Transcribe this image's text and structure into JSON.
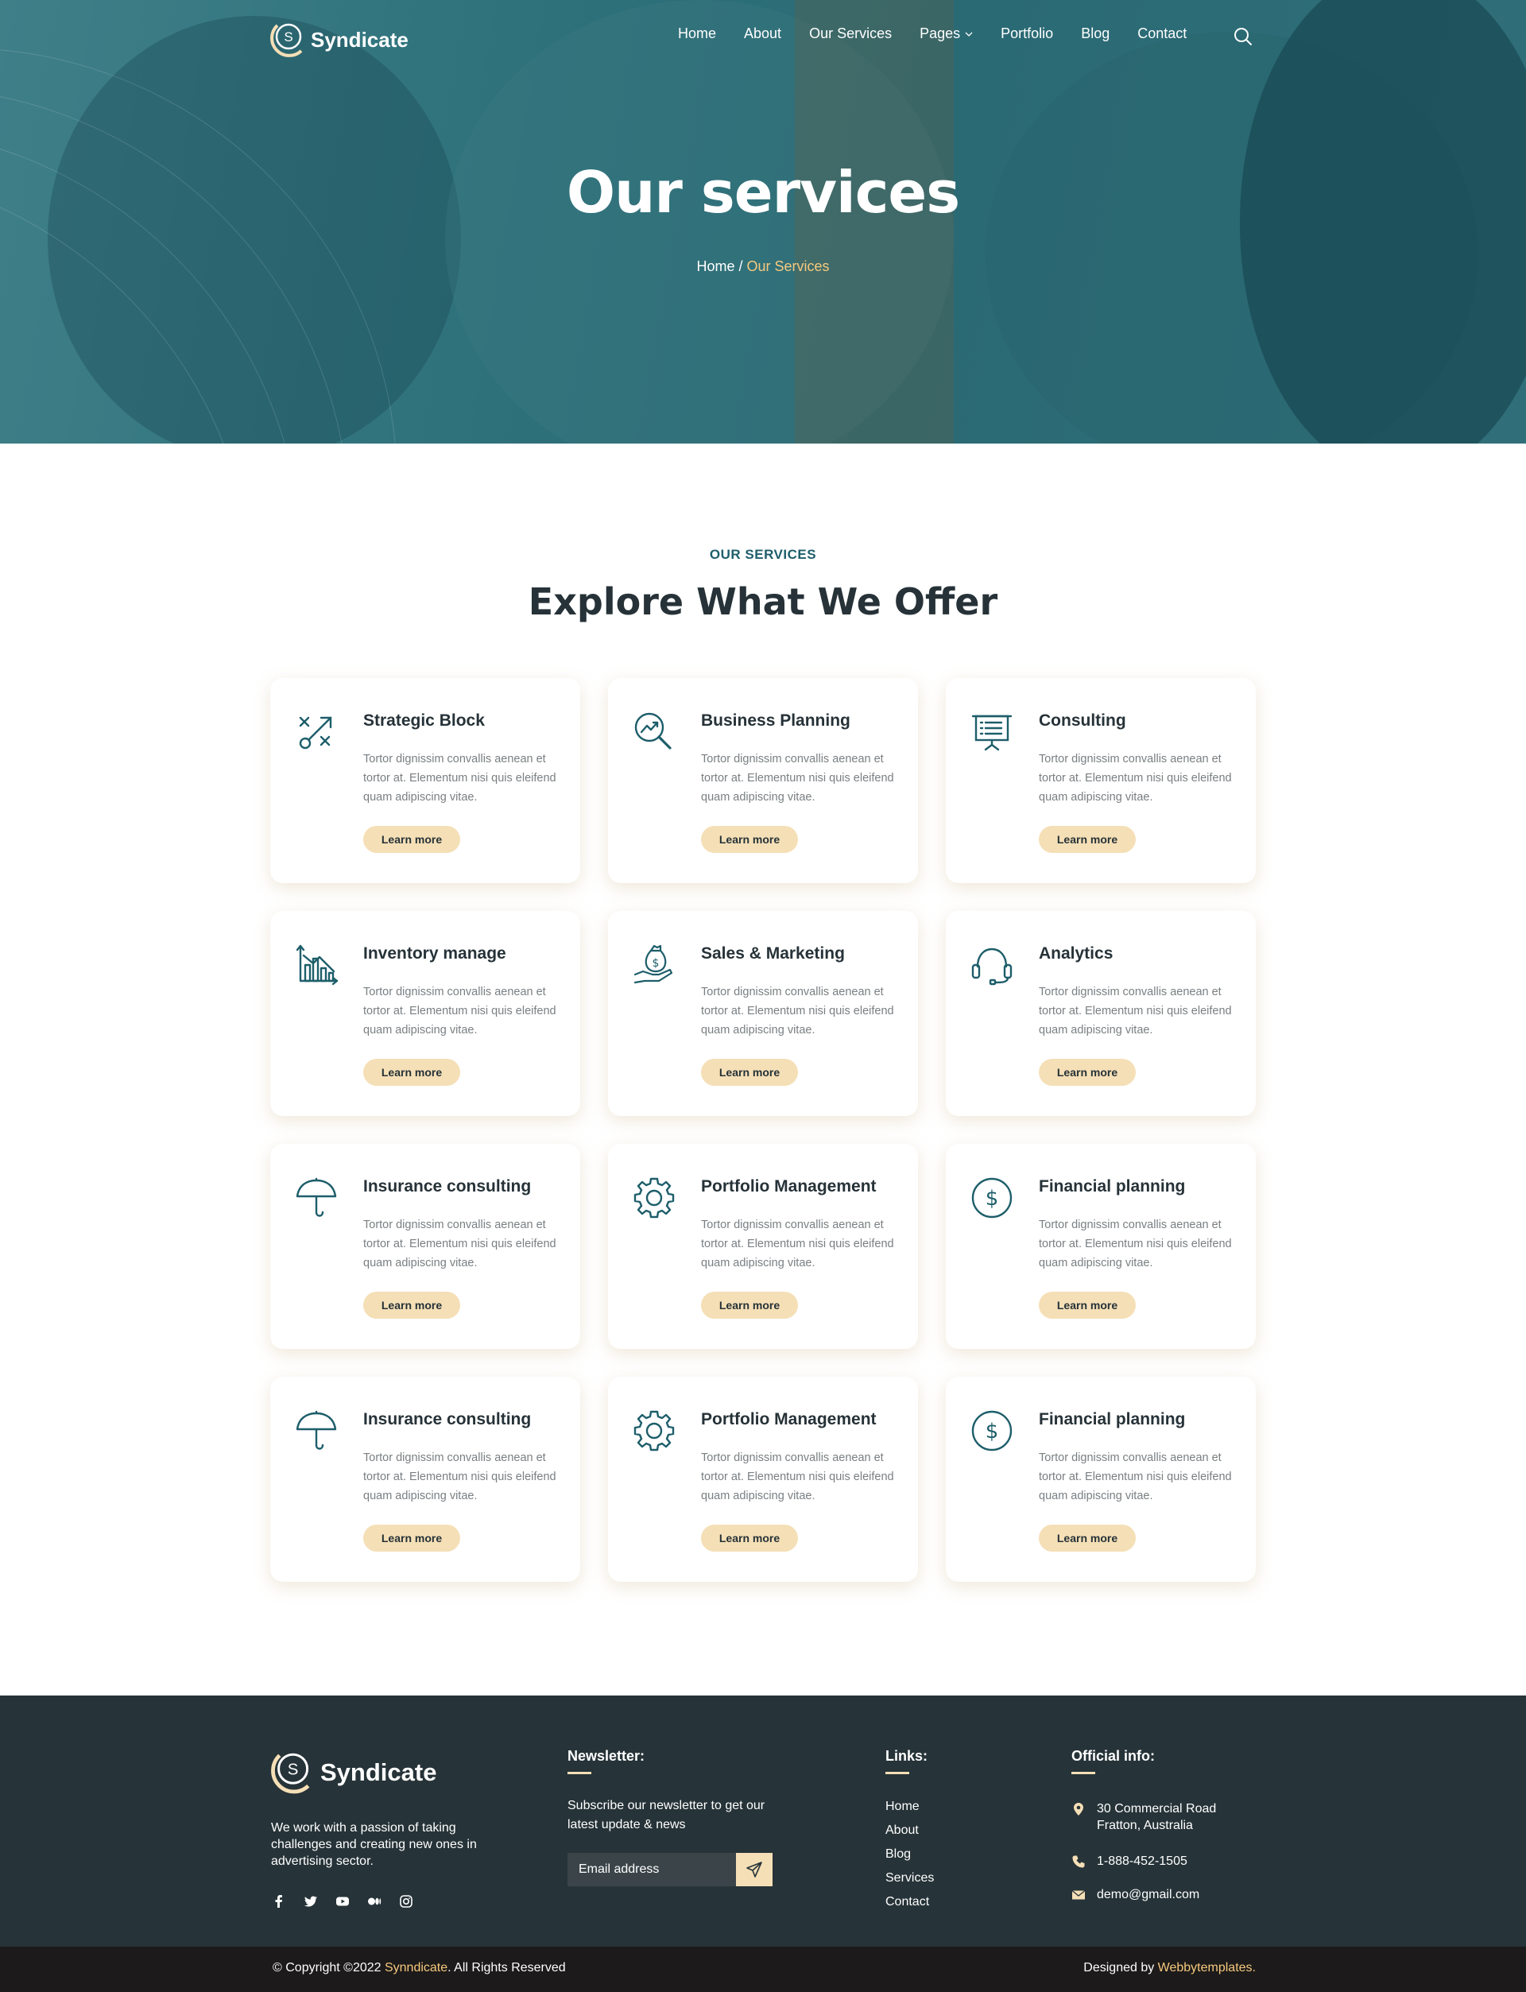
{
  "brand": {
    "name": "Syndicate",
    "logo_letter": "S"
  },
  "nav": {
    "items": [
      {
        "label": "Home"
      },
      {
        "label": "About"
      },
      {
        "label": "Our Services"
      },
      {
        "label": "Pages"
      },
      {
        "label": "Portfolio"
      },
      {
        "label": "Blog"
      },
      {
        "label": "Contact"
      }
    ],
    "search_icon": "search-icon"
  },
  "hero": {
    "title": "Our services",
    "breadcrumb": {
      "home": "Home",
      "separator": " / ",
      "current": "Our Services"
    }
  },
  "services": {
    "eyebrow": "OUR SERVICES",
    "title": "Explore What We Offer",
    "cards": [
      {
        "icon": "strategy-icon",
        "title": "Strategic Block",
        "desc": "Tortor dignissim convallis aenean et tortor at. Elementum nisi quis eleifend quam adipiscing vitae.",
        "button": "Learn more"
      },
      {
        "icon": "business-planning-icon",
        "title": "Business Planning",
        "desc": "Tortor dignissim convallis aenean et tortor at. Elementum nisi quis eleifend quam adipiscing vitae.",
        "button": "Learn more"
      },
      {
        "icon": "presentation-board-icon",
        "title": "Consulting",
        "desc": "Tortor dignissim convallis aenean et tortor at. Elementum nisi quis eleifend quam adipiscing vitae.",
        "button": "Learn more"
      },
      {
        "icon": "bar-chart-icon",
        "title": "Inventory manage",
        "desc": "Tortor dignissim convallis aenean et tortor at. Elementum nisi quis eleifend quam adipiscing vitae.",
        "button": "Learn more"
      },
      {
        "icon": "money-bag-hand-icon",
        "title": "Sales & Marketing",
        "desc": "Tortor dignissim convallis aenean et tortor at. Elementum nisi quis eleifend quam adipiscing vitae.",
        "button": "Learn more"
      },
      {
        "icon": "headset-icon",
        "title": "Analytics",
        "desc": "Tortor dignissim convallis aenean et tortor at. Elementum nisi quis eleifend quam adipiscing vitae.",
        "button": "Learn more"
      },
      {
        "icon": "umbrella-icon",
        "title": "Insurance consulting",
        "desc": "Tortor dignissim convallis aenean et tortor at. Elementum nisi quis eleifend quam adipiscing vitae.",
        "button": "Learn more"
      },
      {
        "icon": "gear-icon",
        "title": "Portfolio Management",
        "desc": "Tortor dignissim convallis aenean et tortor at. Elementum nisi quis eleifend quam adipiscing vitae.",
        "button": "Learn more"
      },
      {
        "icon": "dollar-circle-icon",
        "title": "Financial planning",
        "desc": "Tortor dignissim convallis aenean et tortor at. Elementum nisi quis eleifend quam adipiscing vitae.",
        "button": "Learn more"
      },
      {
        "icon": "umbrella-icon",
        "title": "Insurance consulting",
        "desc": "Tortor dignissim convallis aenean et tortor at. Elementum nisi quis eleifend quam adipiscing vitae.",
        "button": "Learn more"
      },
      {
        "icon": "gear-icon",
        "title": "Portfolio Management",
        "desc": "Tortor dignissim convallis aenean et tortor at. Elementum nisi quis eleifend quam adipiscing vitae.",
        "button": "Learn more"
      },
      {
        "icon": "dollar-circle-icon",
        "title": "Financial planning",
        "desc": "Tortor dignissim convallis aenean et tortor at. Elementum nisi quis eleifend quam adipiscing vitae.",
        "button": "Learn more"
      }
    ]
  },
  "footer": {
    "about": "We work with a passion of taking challenges and creating new ones in advertising sector.",
    "socials": [
      "facebook-icon",
      "twitter-icon",
      "youtube-icon",
      "medium-icon",
      "instagram-icon"
    ],
    "newsletter": {
      "title": "Newsletter:",
      "text": "Subscribe our newsletter to get our latest update & news",
      "placeholder": "Email address"
    },
    "links": {
      "title": "Links:",
      "items": [
        {
          "label": "Home"
        },
        {
          "label": "About"
        },
        {
          "label": "Blog"
        },
        {
          "label": "Services"
        },
        {
          "label": "Contact"
        }
      ]
    },
    "info": {
      "title": "Official info:",
      "address_line1": "30 Commercial Road",
      "address_line2": "Fratton, Australia",
      "phone": "1-888-452-1505",
      "email": "demo@gmail.com"
    },
    "copyright_prefix": "© Copyright ©2022 ",
    "copyright_brand": "Synndicate",
    "copyright_suffix": ". All Rights Reserved",
    "designed_prefix": "Designed by ",
    "designed_brand": "Webbytemplates",
    "designed_suffix": "."
  },
  "colors": {
    "accent_teal": "#1d5e6a",
    "accent_cream": "#f5dfb6",
    "highlight": "#f6c97e",
    "footer_bg": "#263338",
    "bottom_bar_bg": "#1c1a1a"
  }
}
